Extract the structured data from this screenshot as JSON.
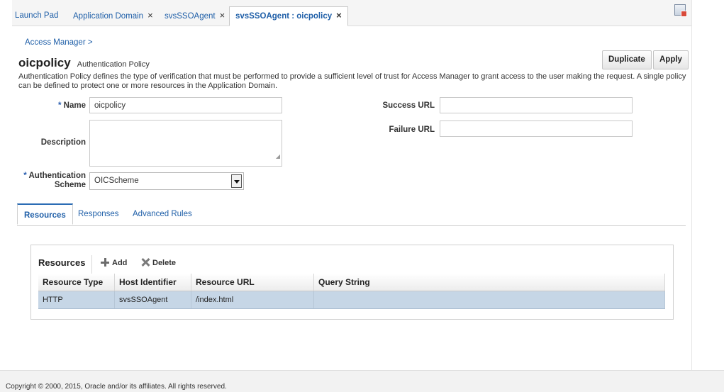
{
  "tabs": [
    {
      "label": "Launch Pad",
      "closable": false
    },
    {
      "label": "Application Domain",
      "closable": true
    },
    {
      "label": "svsSSOAgent",
      "closable": true
    },
    {
      "label": "svsSSOAgent : oicpolicy",
      "closable": true,
      "active": true
    }
  ],
  "tab_close_glyph": "×",
  "breadcrumb": "Access Manager >",
  "page": {
    "title": "oicpolicy",
    "subtitle": "Authentication Policy",
    "description": "Authentication Policy defines the type of verification that must be performed to provide a sufficient level of trust for Access Manager to grant access to the user making the request. A single policy can be defined to protect one or more resources in the Application Domain."
  },
  "buttons": {
    "duplicate": "Duplicate",
    "apply": "Apply"
  },
  "form": {
    "required_marker": "*",
    "name_label": "Name",
    "name_value": "oicpolicy",
    "description_label": "Description",
    "description_value": "",
    "auth_scheme_label_1": "Authentication",
    "auth_scheme_label_2": "Scheme",
    "auth_scheme_value": "OICScheme",
    "success_url_label": "Success URL",
    "success_url_value": "",
    "failure_url_label": "Failure URL",
    "failure_url_value": ""
  },
  "subtabs": [
    "Resources",
    "Responses",
    "Advanced Rules"
  ],
  "resources": {
    "title": "Resources",
    "add_label": "Add",
    "delete_label": "Delete",
    "columns": [
      "Resource Type",
      "Host Identifier",
      "Resource URL",
      "Query String"
    ],
    "rows": [
      [
        "HTTP",
        "svsSSOAgent",
        "/index.html",
        ""
      ]
    ]
  },
  "colors": {
    "link": "#1f5fa8",
    "selected_row": "#c6d6e6",
    "active_tab_accent": "#2c6db5"
  },
  "icons": [
    "toolbar-export-icon",
    "add-plus-icon",
    "delete-x-icon",
    "dropdown-arrow-icon"
  ],
  "footer": "Copyright © 2000, 2015, Oracle and/or its affiliates. All rights reserved."
}
